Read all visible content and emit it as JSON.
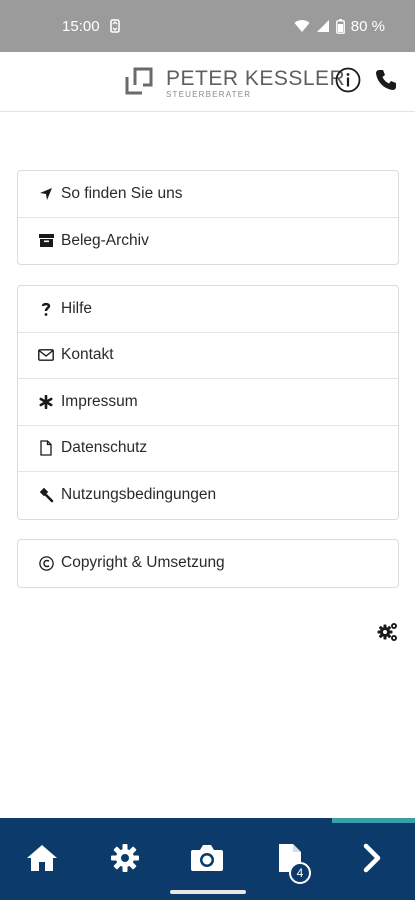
{
  "status_bar": {
    "time": "15:00",
    "battery": "80 %"
  },
  "header": {
    "logo_name": "PETER KESSLER",
    "logo_subtitle": "STEUERBERATER",
    "info_icon": "info-icon",
    "phone_icon": "phone-icon"
  },
  "menu": {
    "group1": [
      {
        "label": "So finden Sie uns",
        "icon": "location-arrow-icon"
      },
      {
        "label": "Beleg-Archiv",
        "icon": "archive-box-icon"
      }
    ],
    "group2": [
      {
        "label": "Hilfe",
        "icon": "question-icon"
      },
      {
        "label": "Kontakt",
        "icon": "envelope-icon"
      },
      {
        "label": "Impressum",
        "icon": "asterisk-icon"
      },
      {
        "label": "Datenschutz",
        "icon": "document-icon"
      },
      {
        "label": "Nutzungsbedingungen",
        "icon": "gavel-icon"
      }
    ],
    "group3": [
      {
        "label": "Copyright & Umsetzung",
        "icon": "copyright-icon"
      }
    ]
  },
  "bottom_nav": {
    "items": [
      "home-icon",
      "settings-gear-icon",
      "camera-icon",
      "documents-icon",
      "next-chevron-icon"
    ],
    "documents_badge": "4",
    "accent_color": "#3aa0a8",
    "background_color": "#0b3a6b"
  }
}
